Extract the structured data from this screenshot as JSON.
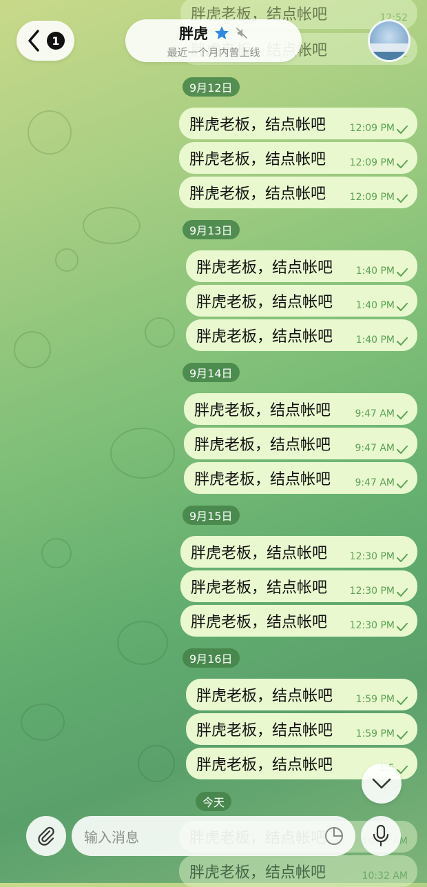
{
  "header": {
    "back_badge": "1",
    "contact_name": "胖虎",
    "status": "最近一个月内曾上线"
  },
  "top_partial": [
    {
      "text": "胖虎老板，结点帐吧",
      "time": "12:52"
    }
  ],
  "groups": [
    {
      "date": "9月12日",
      "messages": [
        {
          "text": "胖虎老板，结点帐吧",
          "time": "12:09 PM"
        },
        {
          "text": "胖虎老板，结点帐吧",
          "time": "12:09 PM"
        },
        {
          "text": "胖虎老板，结点帐吧",
          "time": "12:09 PM"
        }
      ]
    },
    {
      "date": "9月13日",
      "messages": [
        {
          "text": "胖虎老板，结点帐吧",
          "time": "1:40 PM"
        },
        {
          "text": "胖虎老板，结点帐吧",
          "time": "1:40 PM"
        },
        {
          "text": "胖虎老板，结点帐吧",
          "time": "1:40 PM"
        }
      ]
    },
    {
      "date": "9月14日",
      "messages": [
        {
          "text": "胖虎老板，结点帐吧",
          "time": "9:47 AM"
        },
        {
          "text": "胖虎老板，结点帐吧",
          "time": "9:47 AM"
        },
        {
          "text": "胖虎老板，结点帐吧",
          "time": "9:47 AM"
        }
      ]
    },
    {
      "date": "9月15日",
      "messages": [
        {
          "text": "胖虎老板，结点帐吧",
          "time": "12:30 PM"
        },
        {
          "text": "胖虎老板，结点帐吧",
          "time": "12:30 PM"
        },
        {
          "text": "胖虎老板，结点帐吧",
          "time": "12:30 PM"
        }
      ]
    },
    {
      "date": "9月16日",
      "messages": [
        {
          "text": "胖虎老板，结点帐吧",
          "time": "1:59 PM"
        },
        {
          "text": "胖虎老板，结点帐吧",
          "time": "1:59 PM"
        },
        {
          "text": "胖虎老板，结点帐吧",
          "time": "1:5"
        }
      ]
    },
    {
      "date": "今天",
      "messages": [
        {
          "text": "胖虎老板，结点帐吧",
          "time": "10:32 AM"
        }
      ]
    }
  ],
  "input": {
    "placeholder": "输入消息"
  },
  "colors": {
    "bubble": "#e9f8cf",
    "date_chip": "#448248",
    "check": "#5aa353",
    "star": "#2d8ae6"
  },
  "icons": [
    "chevron-left-icon",
    "star-icon",
    "muted-speaker-icon",
    "chevron-down-icon",
    "paperclip-icon",
    "sticker-icon",
    "microphone-icon",
    "double-check-icon"
  ]
}
